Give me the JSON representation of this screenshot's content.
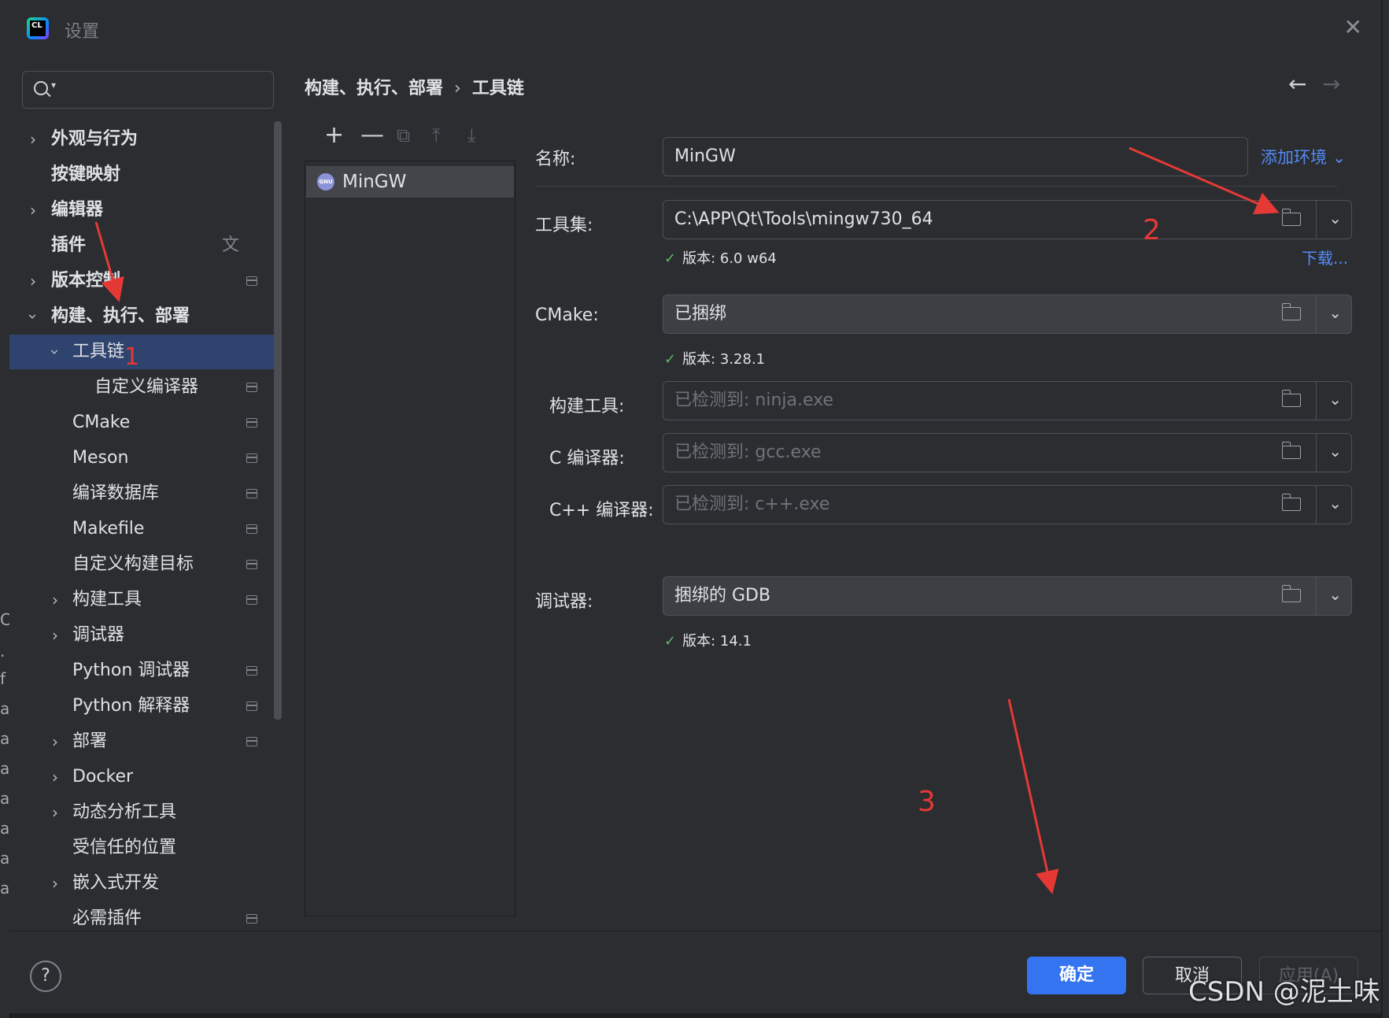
{
  "window": {
    "title": "设置"
  },
  "search": {
    "placeholder": ""
  },
  "tree": [
    {
      "label": "外观与行为"
    },
    {
      "label": "按键映射"
    },
    {
      "label": "编辑器"
    },
    {
      "label": "插件"
    },
    {
      "label": "版本控制"
    },
    {
      "label": "构建、执行、部署"
    },
    {
      "label": "工具链"
    },
    {
      "label": "自定义编译器"
    },
    {
      "label": "CMake"
    },
    {
      "label": "Meson"
    },
    {
      "label": "编译数据库"
    },
    {
      "label": "Makefile"
    },
    {
      "label": "自定义构建目标"
    },
    {
      "label": "构建工具"
    },
    {
      "label": "调试器"
    },
    {
      "label": "Python 调试器"
    },
    {
      "label": "Python 解释器"
    },
    {
      "label": "部署"
    },
    {
      "label": "Docker"
    },
    {
      "label": "动态分析工具"
    },
    {
      "label": "受信任的位置"
    },
    {
      "label": "嵌入式开发"
    },
    {
      "label": "必需插件"
    }
  ],
  "breadcrumb": {
    "parent": "构建、执行、部署",
    "current": "工具链"
  },
  "toolchains": [
    {
      "name": "MinGW",
      "icon": "gnu-icon"
    }
  ],
  "form": {
    "name_label": "名称:",
    "name_value": "MinGW",
    "add_env": "添加环境",
    "toolset_label": "工具集:",
    "toolset_value": "C:\\APP\\Qt\\Tools\\mingw730_64",
    "toolset_version": "版本: 6.0 w64",
    "download": "下载...",
    "cmake_label": "CMake:",
    "cmake_value": "已捆绑",
    "cmake_version": "版本: 3.28.1",
    "build_tool_label": "构建工具:",
    "build_tool_placeholder": "已检测到: ninja.exe",
    "c_compiler_label": "C 编译器:",
    "c_compiler_placeholder": "已检测到: gcc.exe",
    "cpp_compiler_label": "C++ 编译器:",
    "cpp_compiler_placeholder": "已检测到: c++.exe",
    "debugger_label": "调试器:",
    "debugger_value": "捆绑的 GDB",
    "debugger_version": "版本: 14.1"
  },
  "buttons": {
    "ok": "确定",
    "cancel": "取消",
    "apply": "应用(A)"
  },
  "annotations": {
    "n1": "1",
    "n2": "2",
    "n3": "3"
  },
  "watermark": "CSDN @泥土味",
  "colors": {
    "accent": "#3574f0",
    "selection": "#2e436e",
    "annotation": "#e53935",
    "link": "#548af7"
  }
}
